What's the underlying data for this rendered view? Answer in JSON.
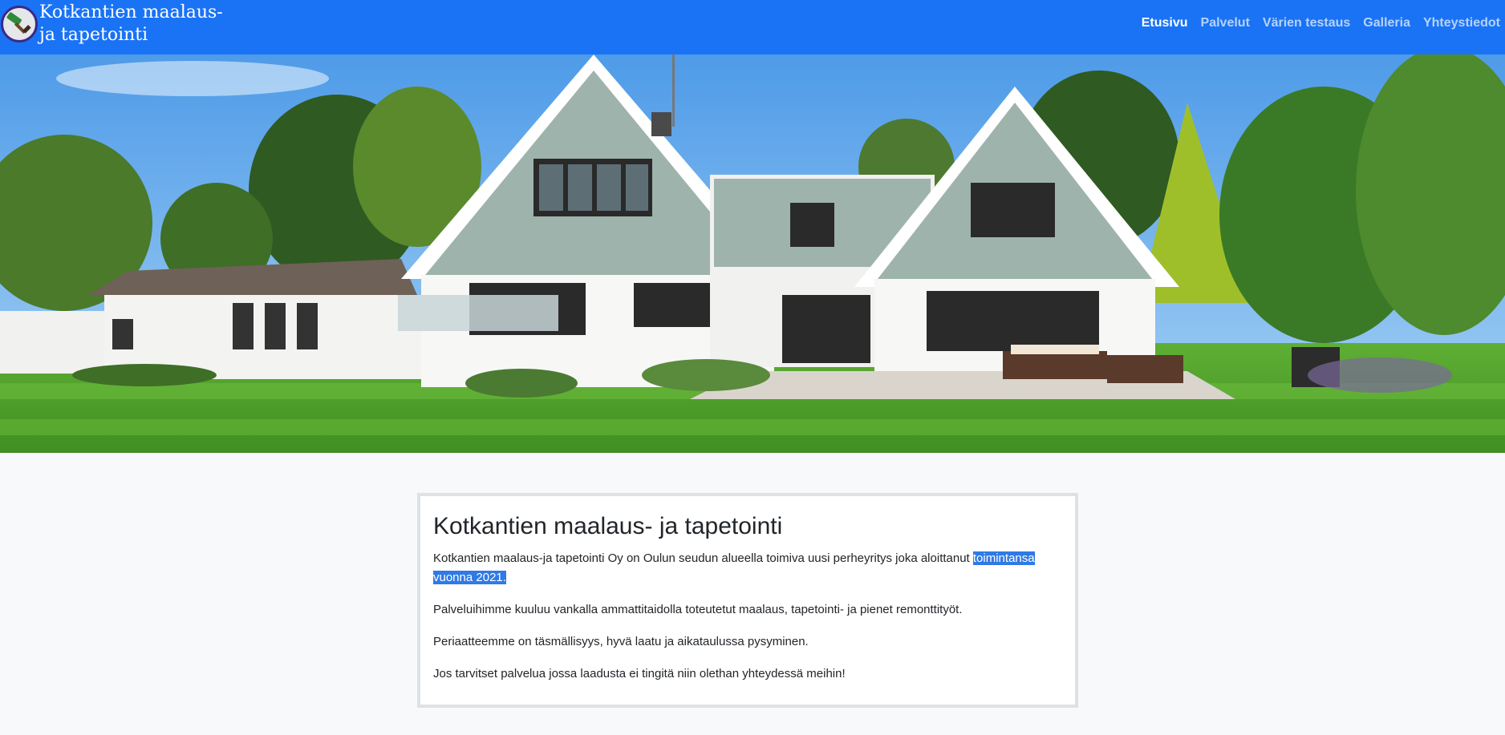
{
  "brand": {
    "name": "Kotkantien maalaus-\nja tapetointi"
  },
  "nav": {
    "items": [
      {
        "label": "Etusivu",
        "active": true
      },
      {
        "label": "Palvelut"
      },
      {
        "label": "Värien testaus"
      },
      {
        "label": "Galleria"
      },
      {
        "label": "Yhteystiedot"
      }
    ]
  },
  "main": {
    "title": "Kotkantien maalaus- ja tapetointi",
    "intro_start": "Kotkantien maalaus-ja tapetointi Oy on Oulun seudun alueella toimiva uusi perheyritys joka aloittanut ",
    "intro_selected": "toimintansa vuonna 2021.",
    "p2": "Palveluihimme kuuluu vankalla ammattitaidolla toteutetut maalaus, tapetointi- ja pienet remonttityöt.",
    "p3": "Periaatteemme on täsmällisyys, hyvä laatu ja aikataulussa pysyminen.",
    "p4": "Jos tarvitset palvelua jossa laadusta ei tingitä niin olethan yhteydessä meihin!"
  },
  "colors": {
    "navbar": "#1a73f5",
    "selection": "#2f7ae5",
    "page_bg": "#f8f9fa"
  }
}
